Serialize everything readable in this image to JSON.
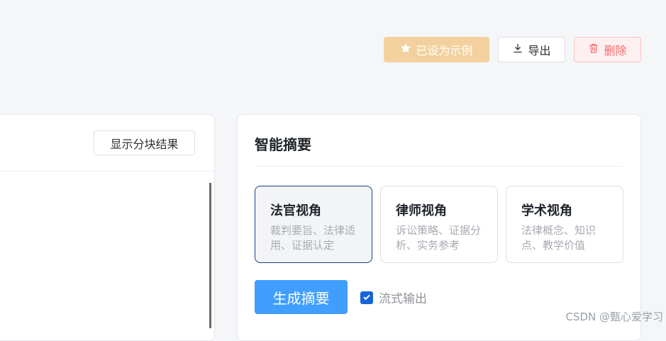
{
  "toolbar": {
    "example_label": "已设为示例",
    "export_label": "导出",
    "delete_label": "删除",
    "colors": {
      "example_bg": "#f3d19e",
      "delete_fg": "#f56c6c"
    }
  },
  "left_panel": {
    "show_chunks_label": "显示分块结果"
  },
  "summary_panel": {
    "title": "智能摘要",
    "perspectives": [
      {
        "title": "法官视角",
        "desc": "裁判要旨、法律适用、证据认定",
        "selected": true
      },
      {
        "title": "律师视角",
        "desc": "诉讼策略、证据分析、实务参考",
        "selected": false
      },
      {
        "title": "学术视角",
        "desc": "法律概念、知识点、教学价值",
        "selected": false
      }
    ],
    "generate_label": "生成摘要",
    "stream_label": "流式输出",
    "stream_checked": true
  },
  "watermark": "CSDN @甄心爱学习",
  "icons": [
    "star-icon",
    "download-icon",
    "trash-icon",
    "check-icon"
  ]
}
